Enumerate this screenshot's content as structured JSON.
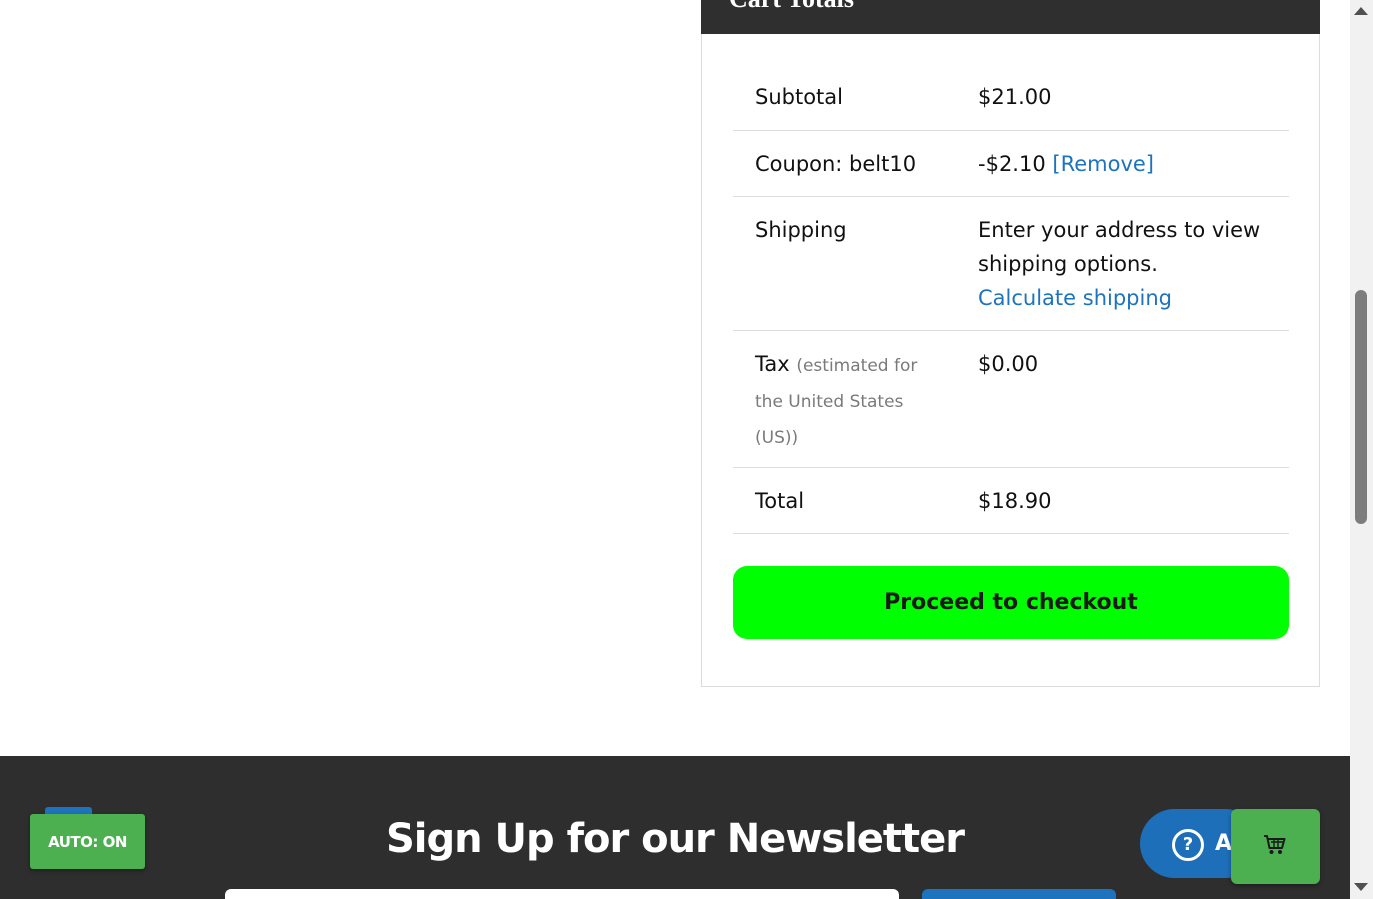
{
  "cart_totals": {
    "heading": "Cart Totals",
    "rows": {
      "subtotal": {
        "label": "Subtotal",
        "value": "$21.00"
      },
      "coupon": {
        "label": "Coupon: belt10",
        "value": "-$2.10",
        "remove_label": "[Remove]"
      },
      "shipping": {
        "label": "Shipping",
        "message_line1": "Enter your address to view",
        "message_line2": "shipping options.",
        "calculate_label": "Calculate shipping"
      },
      "tax": {
        "label": "Tax",
        "note_line1": "(estimated for",
        "note_line2": "the United States",
        "note_line3": "(US))",
        "value": "$0.00"
      },
      "total": {
        "label": "Total",
        "value": "$18.90"
      }
    },
    "checkout_label": "Proceed to checkout"
  },
  "newsletter": {
    "title": "Sign Up for our Newsletter"
  },
  "widgets": {
    "auto_label": "AUTO: ON",
    "help_icon_glyph": "?",
    "help_label_partial": "A"
  },
  "icons": {
    "help": "question-circle-icon",
    "cart": "shopping-cart-icon"
  },
  "colors": {
    "checkout_button": "#00ff00",
    "link": "#1e73be",
    "header_bg": "#2f2f2f",
    "footer_bg": "#2e2e2e",
    "auto_button": "#4caf50",
    "help_button": "#1e6fba"
  }
}
